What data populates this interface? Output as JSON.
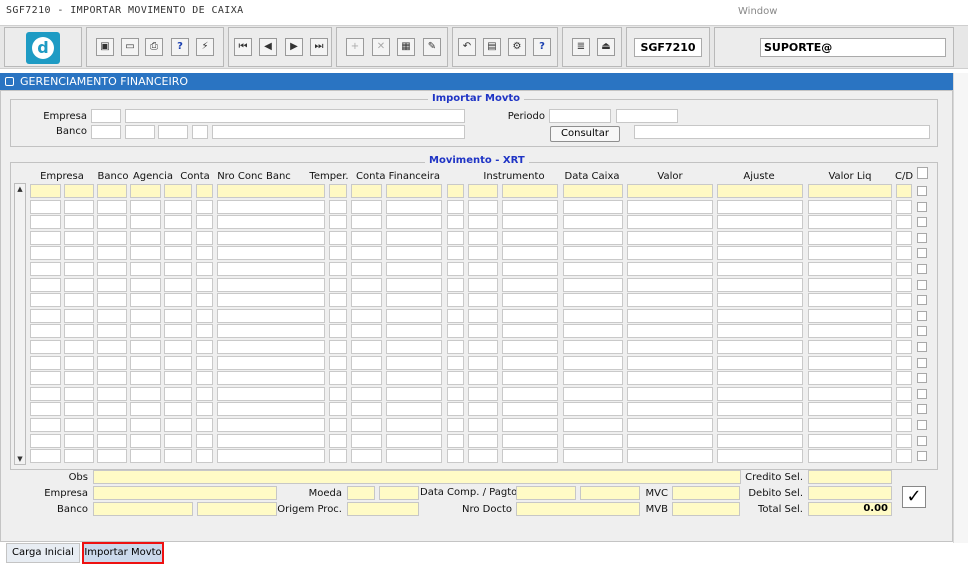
{
  "window": {
    "title": "SGF7210 - IMPORTAR MOVIMENTO DE CAIXA",
    "menu": "Window"
  },
  "toolbar": {
    "logo_letter": "d",
    "buttons": [
      {
        "name": "save-icon",
        "glyph": "▣"
      },
      {
        "name": "print-preview-icon",
        "glyph": "▭"
      },
      {
        "name": "print-icon",
        "glyph": "⎙"
      },
      {
        "name": "help-query-icon",
        "glyph": "?"
      },
      {
        "name": "run-query-icon",
        "glyph": "⚡"
      },
      {
        "name": "first-record-icon",
        "glyph": "⏮"
      },
      {
        "name": "previous-record-icon",
        "glyph": "◀"
      },
      {
        "name": "next-record-icon",
        "glyph": "▶"
      },
      {
        "name": "last-record-icon",
        "glyph": "⏭"
      },
      {
        "name": "insert-record-icon",
        "glyph": "+"
      },
      {
        "name": "delete-record-icon",
        "glyph": "✕"
      },
      {
        "name": "clear-form-icon",
        "glyph": "▦"
      },
      {
        "name": "edit-icon",
        "glyph": "✎"
      },
      {
        "name": "undo-icon",
        "glyph": "↶"
      },
      {
        "name": "clipboard-icon",
        "glyph": "▤"
      },
      {
        "name": "settings-icon",
        "glyph": "⚙"
      },
      {
        "name": "help-icon",
        "glyph": "?"
      },
      {
        "name": "menu-icon",
        "glyph": "≣"
      },
      {
        "name": "exit-icon",
        "glyph": "⏏"
      }
    ],
    "form_code": "SGF7210",
    "user": "SUPORTE@"
  },
  "panel": {
    "title": "GERENCIAMENTO FINANCEIRO"
  },
  "import_section": {
    "title": "Importar Movto",
    "empresa_label": "Empresa",
    "banco_label": "Banco",
    "periodo_label": "Periodo",
    "consultar_label": "Consultar"
  },
  "grid": {
    "title": "Movimento - XRT",
    "columns": [
      "Empresa",
      "Banco",
      "Agencia",
      "Conta",
      "Nro Conc Banc",
      "Temper.",
      "Conta Financeira",
      "Instrumento",
      "Data Caixa",
      "Valor",
      "Ajuste",
      "Valor Liq",
      "C/D"
    ],
    "row_count": 18
  },
  "footer": {
    "obs_label": "Obs",
    "empresa_label": "Empresa",
    "banco_label": "Banco",
    "moeda_label": "Moeda",
    "origem_label": "Origem Proc.",
    "data_comp_label": "Data Comp. / Pagto",
    "nro_docto_label": "Nro Docto",
    "mvc_label": "MVC",
    "mvb_label": "MVB",
    "credito_label": "Credito Sel.",
    "debito_label": "Debito Sel.",
    "total_label": "Total Sel.",
    "total_value": "0.00",
    "check_glyph": "✓"
  },
  "tabs": [
    {
      "label": "Carga Inicial"
    },
    {
      "label": "Importar Movto"
    }
  ]
}
